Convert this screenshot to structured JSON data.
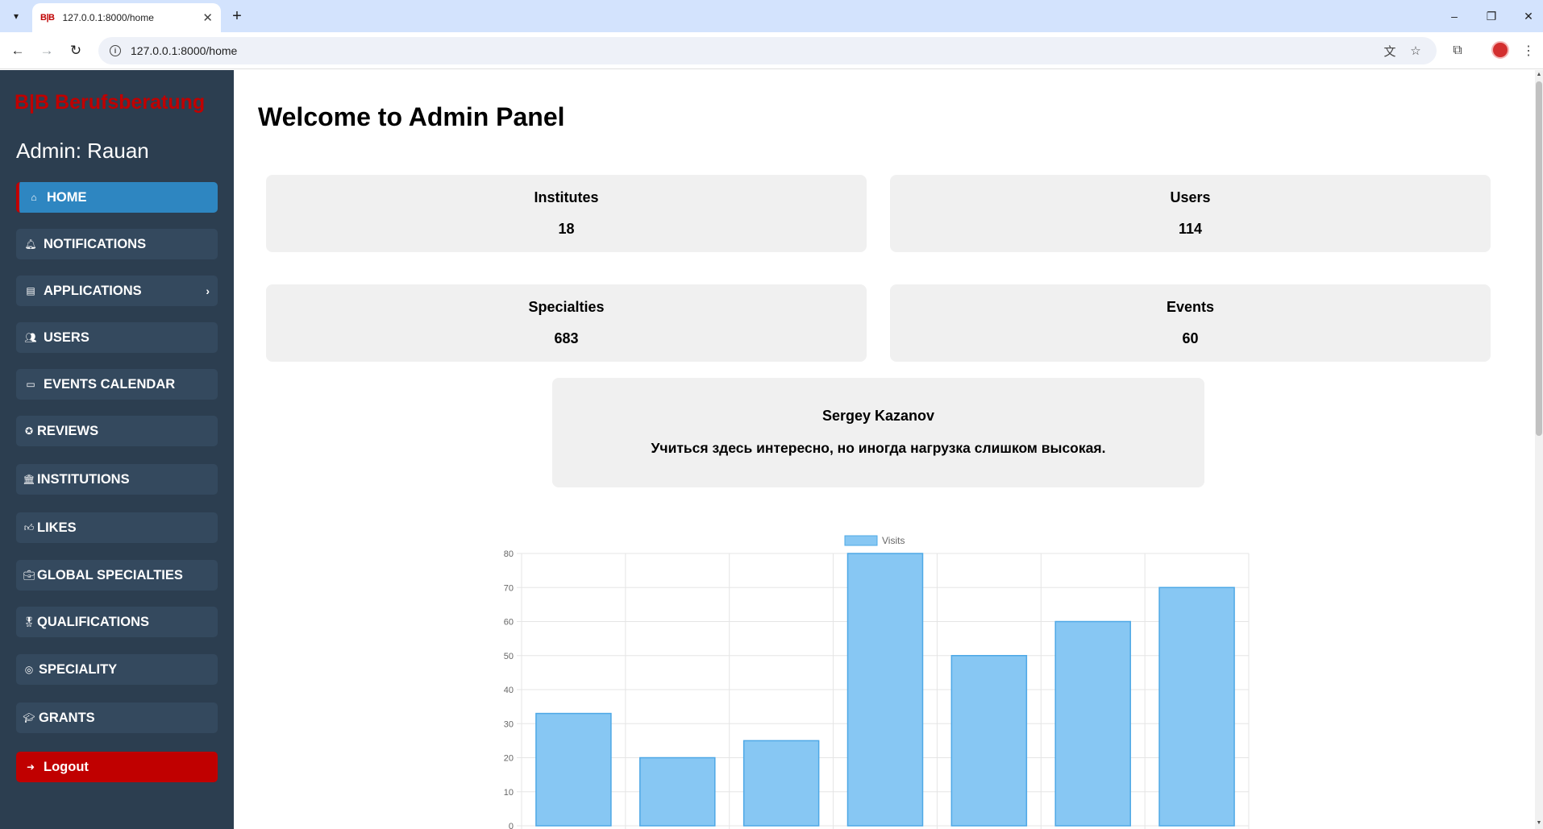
{
  "browser": {
    "tab_title": "127.0.0.1:8000/home",
    "tab_favicon": "B|B",
    "url": "127.0.0.1:8000/home",
    "icons": {
      "tab_menu": "chevron-down-icon",
      "close": "close-icon",
      "new_tab": "plus-icon",
      "back": "arrow-left-icon",
      "forward": "arrow-right-icon",
      "reload": "reload-icon",
      "info": "info-icon",
      "translate": "translate-icon",
      "bookmark": "star-icon",
      "extensions": "puzzle-icon",
      "menu": "kebab-menu-icon"
    }
  },
  "sidebar": {
    "brand": "B|B  Berufsberatung",
    "admin_label": "Admin: Rauan",
    "items": [
      {
        "label": "HOME",
        "icon": "home-icon",
        "glyph": "⌂"
      },
      {
        "label": "NOTIFICATIONS",
        "icon": "bell-icon",
        "glyph": "🔔︎"
      },
      {
        "label": "APPLICATIONS",
        "icon": "applications-icon",
        "glyph": "▤"
      },
      {
        "label": "USERS",
        "icon": "users-icon",
        "glyph": "👥︎"
      },
      {
        "label": "EVENTS CALENDAR",
        "icon": "calendar-icon",
        "glyph": "▭"
      },
      {
        "label": "REVIEWS",
        "icon": "star-circle-icon",
        "glyph": "✪"
      },
      {
        "label": "INSTITUTIONS",
        "icon": "institution-icon",
        "glyph": "🏛︎"
      },
      {
        "label": "LIKES",
        "icon": "thumbs-up-icon",
        "glyph": "👍︎"
      },
      {
        "label": "GLOBAL SPECIALTIES",
        "icon": "briefcase-icon",
        "glyph": "💼︎"
      },
      {
        "label": "QUALIFICATIONS",
        "icon": "award-icon",
        "glyph": "🎖︎"
      },
      {
        "label": "SPECIALITY",
        "icon": "speciality-icon",
        "glyph": "◎"
      },
      {
        "label": "GRANTS",
        "icon": "grant-icon",
        "glyph": "🎓︎"
      }
    ],
    "logout": {
      "label": "Logout",
      "icon": "logout-icon",
      "glyph": "➜"
    }
  },
  "main": {
    "title": "Welcome to Admin Panel",
    "stats": [
      {
        "label": "Institutes",
        "value": "18"
      },
      {
        "label": "Users",
        "value": "114"
      },
      {
        "label": "Specialties",
        "value": "683"
      },
      {
        "label": "Events",
        "value": "60"
      }
    ],
    "review": {
      "author": "Sergey Kazanov",
      "text": "Учиться здесь интересно, но иногда нагрузка слишком высокая."
    }
  },
  "chart_data": {
    "type": "bar",
    "series": [
      {
        "name": "Visits",
        "values": [
          33,
          20,
          25,
          80,
          50,
          60,
          70
        ]
      }
    ],
    "ylim": [
      0,
      80
    ],
    "y_ticks": [
      0,
      10,
      20,
      30,
      40,
      50,
      60,
      70,
      80
    ],
    "grid": true,
    "legend_position": "top",
    "colors": {
      "fill": "#87c7f3",
      "stroke": "#4ea8e6"
    }
  }
}
